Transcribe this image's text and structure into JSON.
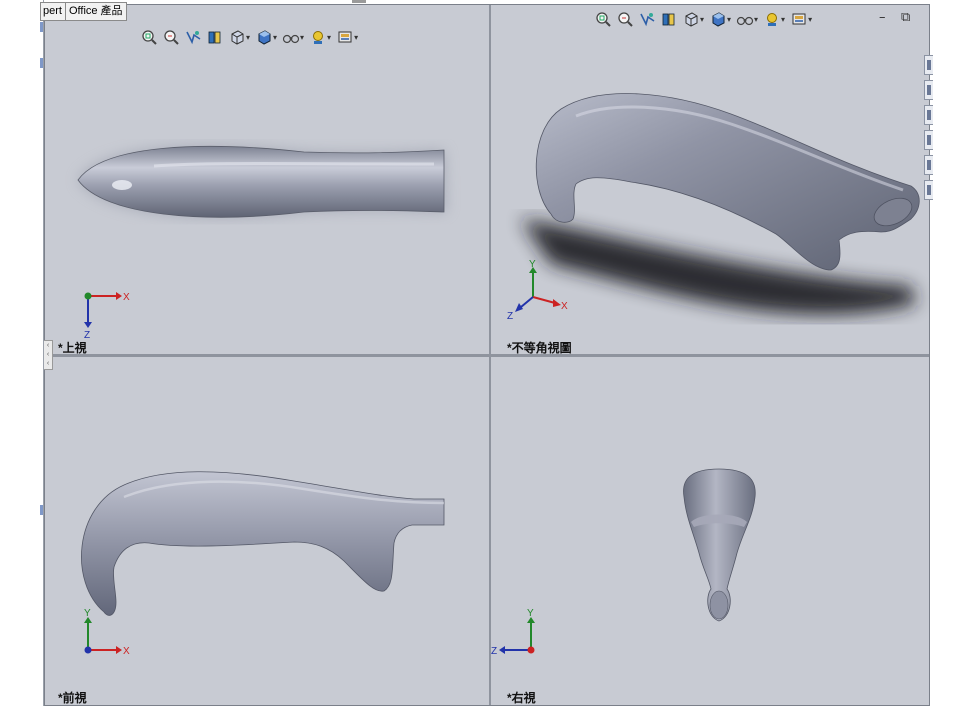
{
  "tabs": [
    {
      "label": "pert",
      "partial": true
    },
    {
      "label": "Office 產品"
    }
  ],
  "heads_up_toolbar": {
    "icons": [
      "zoom-to-fit-icon",
      "zoom-to-area-icon",
      "previous-view-icon",
      "section-view-icon",
      "view-orientation-icon",
      "display-style-icon",
      "hide-show-items-icon",
      "edit-appearance-icon",
      "apply-scene-icon"
    ]
  },
  "window_controls": {
    "minimize": "–",
    "restore": "⧉",
    "close": "✕"
  },
  "viewports": {
    "top": {
      "label": "*上視",
      "axes": {
        "h": "X",
        "v": "Z"
      }
    },
    "isometric": {
      "label": "*不等角視圖",
      "axes": {
        "h": "X",
        "v": "Y",
        "d": "Z"
      }
    },
    "front": {
      "label": "*前視",
      "axes": {
        "h": "X",
        "v": "Y"
      }
    },
    "right": {
      "label": "*右視",
      "axes": {
        "h": "Z",
        "v": "Y"
      }
    }
  },
  "colors": {
    "viewport_bg": "#c8cbd3",
    "model": "#8e93a4",
    "axis_x": "#cc2222",
    "axis_y": "#22882a",
    "axis_z": "#2233aa"
  }
}
